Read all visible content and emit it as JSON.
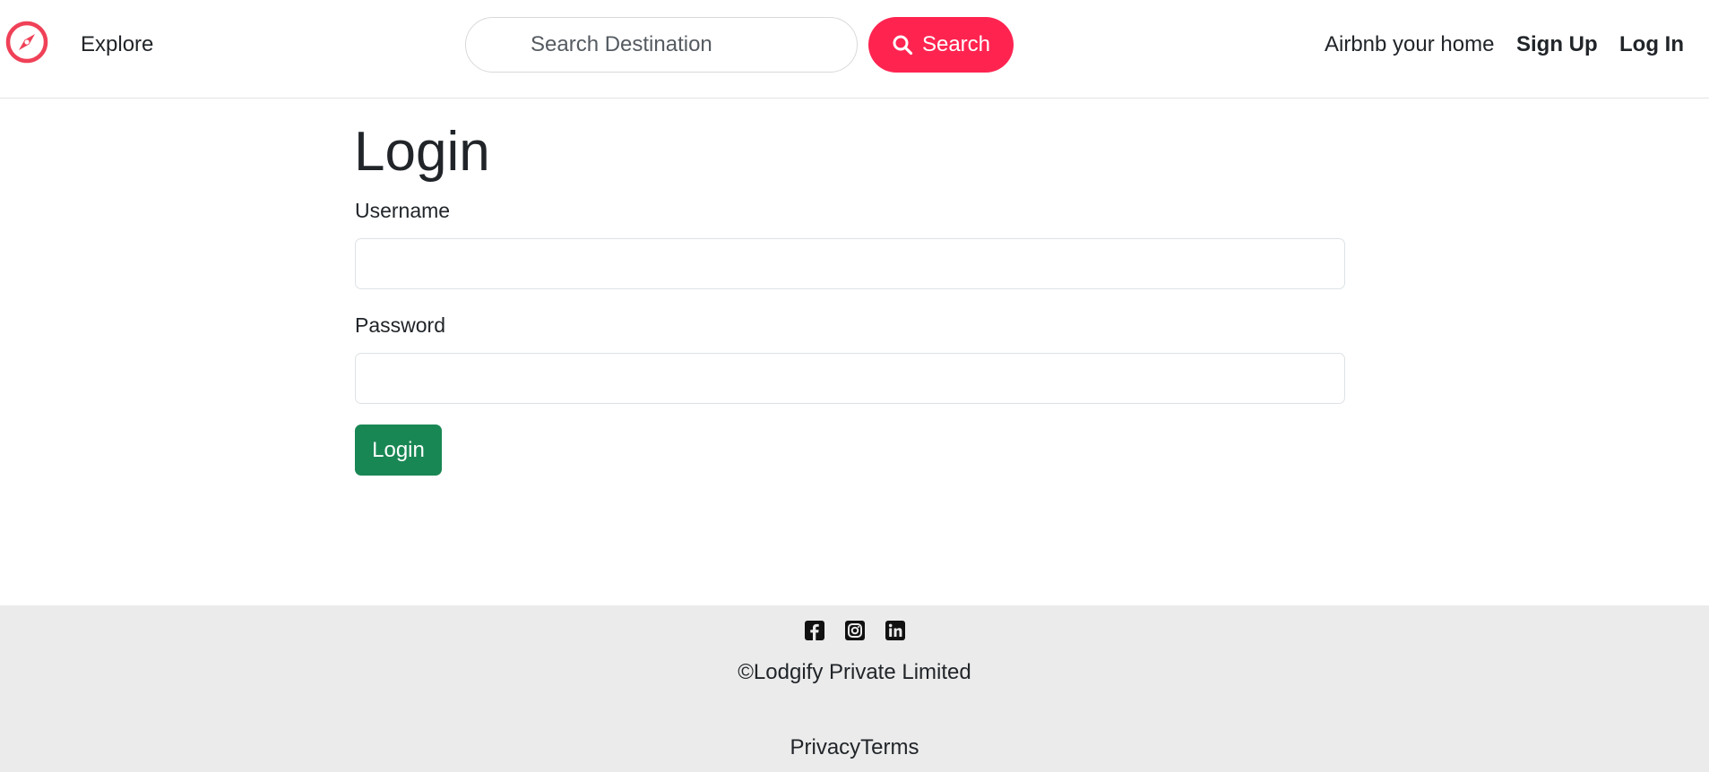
{
  "colors": {
    "brand": "#ff2450",
    "login_button": "#198754",
    "footer_bg": "#ebebeb",
    "logo": "#ef4157"
  },
  "navbar": {
    "logo_icon": "compass-icon",
    "explore": "Explore",
    "search": {
      "placeholder": "Search Destination",
      "value": "",
      "button_label": "Search",
      "button_icon": "search-icon"
    },
    "links": {
      "airbnb_home": "Airbnb your home",
      "sign_up": "Sign Up",
      "log_in": "Log In"
    }
  },
  "login_form": {
    "title": "Login",
    "username_label": "Username",
    "username_value": "",
    "password_label": "Password",
    "password_value": "",
    "submit_label": "Login"
  },
  "footer": {
    "social_icons": [
      "facebook-icon",
      "instagram-icon",
      "linkedin-icon"
    ],
    "copyright": "©Lodgify Private Limited",
    "privacy": "Privacy",
    "terms": "Terms"
  }
}
